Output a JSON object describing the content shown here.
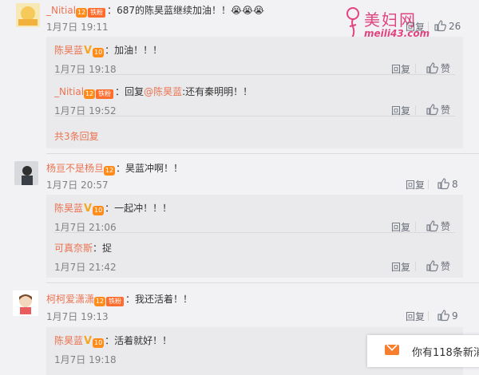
{
  "watermark": {
    "brand": "美妇网",
    "url": "meili43.com"
  },
  "comments": [
    {
      "user": "_Nitial",
      "level": "12",
      "fan_badge": "铁粉",
      "sep": "：",
      "text": "687的陈昊蓝继续加油！！",
      "emoji": "😭😭😭",
      "time": "1月7日 19:11",
      "reply_label": "回复",
      "like_count": "26",
      "replies": [
        {
          "user": "陈昊蓝",
          "verified": "V",
          "level": "10",
          "sep": "：",
          "text": "加油！！！",
          "time": "1月7日 19:18",
          "reply_label": "回复",
          "like_label": "赞"
        },
        {
          "user": "_Nitial",
          "level": "12",
          "fan_badge": "铁粉",
          "sep": "：",
          "prefix": "回复",
          "mention": "@陈昊蓝",
          "text": ":还有秦明明！！",
          "time": "1月7日 19:52",
          "reply_label": "回复",
          "like_label": "赞"
        }
      ],
      "more_replies": "共3条回复"
    },
    {
      "user": "杨亘不是杨旦",
      "level": "12",
      "sep": "：",
      "text": "昊蓝冲啊！！",
      "time": "1月7日 20:57",
      "reply_label": "回复",
      "like_count": "8",
      "replies": [
        {
          "user": "陈昊蓝",
          "verified": "V",
          "level": "10",
          "sep": "：",
          "text": "一起冲！！！",
          "time": "1月7日 21:06",
          "reply_label": "回复",
          "like_label": "赞"
        },
        {
          "user": "可真奈斯",
          "sep": "：",
          "text": "捉",
          "time": "1月7日 21:42",
          "reply_label": "回复",
          "like_label": "赞"
        }
      ]
    },
    {
      "user": "柯柯爱潇潇",
      "level": "12",
      "fan_badge": "铁粉",
      "sep": "：",
      "text": "我还活着！！",
      "time": "1月7日 19:13",
      "reply_label": "回复",
      "like_count": "9",
      "replies": [
        {
          "user": "陈昊蓝",
          "verified": "V",
          "level": "10",
          "sep": "：",
          "text": "活着就好！！",
          "time": "1月7日 19:18"
        }
      ]
    }
  ],
  "notification": {
    "text": "你有118条新消"
  }
}
